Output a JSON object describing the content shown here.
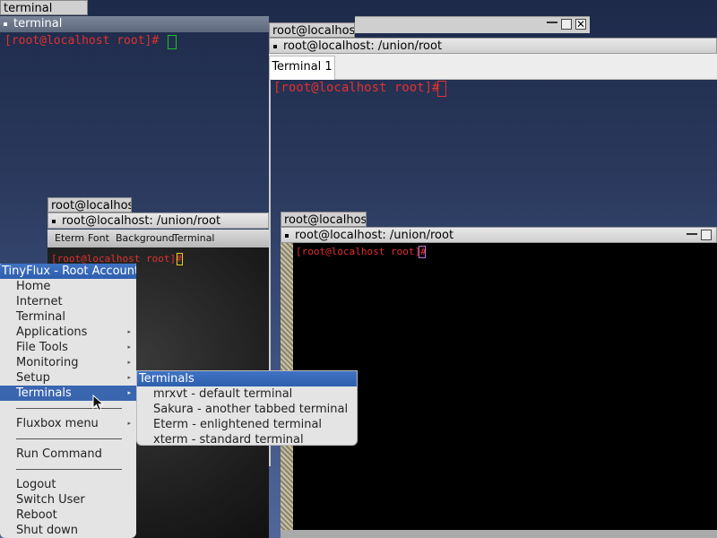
{
  "top_tab": {
    "label": "terminal"
  },
  "win_terminal": {
    "title": "terminal",
    "prompt": "[root@localhost root]#",
    "colors": {
      "prompt": "#e23030",
      "cursor": "#20c020"
    }
  },
  "win_sakura": {
    "tab_label": "root@localhos",
    "title": "root@localhost: /union/root",
    "tab": "Terminal 1",
    "prompt": "[root@localhost root]#"
  },
  "win_eterm": {
    "tab_label": "root@localhos",
    "title": "root@localhost: /union/root",
    "menubar": [
      "Eterm",
      "Font",
      "Background",
      "Terminal"
    ],
    "prompt": "[root@localhost root]#"
  },
  "win_mrxvt": {
    "tab_label": "root@localhos",
    "title": "root@localhost: /union/root",
    "prompt": "[root@localhost root]#"
  },
  "root_menu": {
    "title": "TinyFlux - Root Account",
    "items": [
      {
        "label": "Home"
      },
      {
        "label": "Internet"
      },
      {
        "label": "Terminal"
      },
      {
        "label": "Applications"
      },
      {
        "label": "File Tools"
      },
      {
        "label": "Monitoring"
      },
      {
        "label": "Setup"
      },
      {
        "label": "Terminals"
      },
      {
        "label": "Fluxbox menu"
      },
      {
        "label": "Run Command"
      },
      {
        "label": "Logout"
      },
      {
        "label": "Switch User"
      },
      {
        "label": "Reboot"
      },
      {
        "label": "Shut down"
      }
    ]
  },
  "submenu_terminals": {
    "title": "Terminals",
    "items": [
      {
        "label": "mrxvt - default terminal"
      },
      {
        "label": "Sakura - another tabbed terminal"
      },
      {
        "label": "Eterm - enlightened terminal"
      },
      {
        "label": "xterm - standard terminal"
      }
    ]
  },
  "icons": [
    "window-menu-dot-icon",
    "minimize-icon",
    "maximize-icon",
    "close-icon",
    "submenu-arrow-icon",
    "mouse-pointer-icon"
  ]
}
